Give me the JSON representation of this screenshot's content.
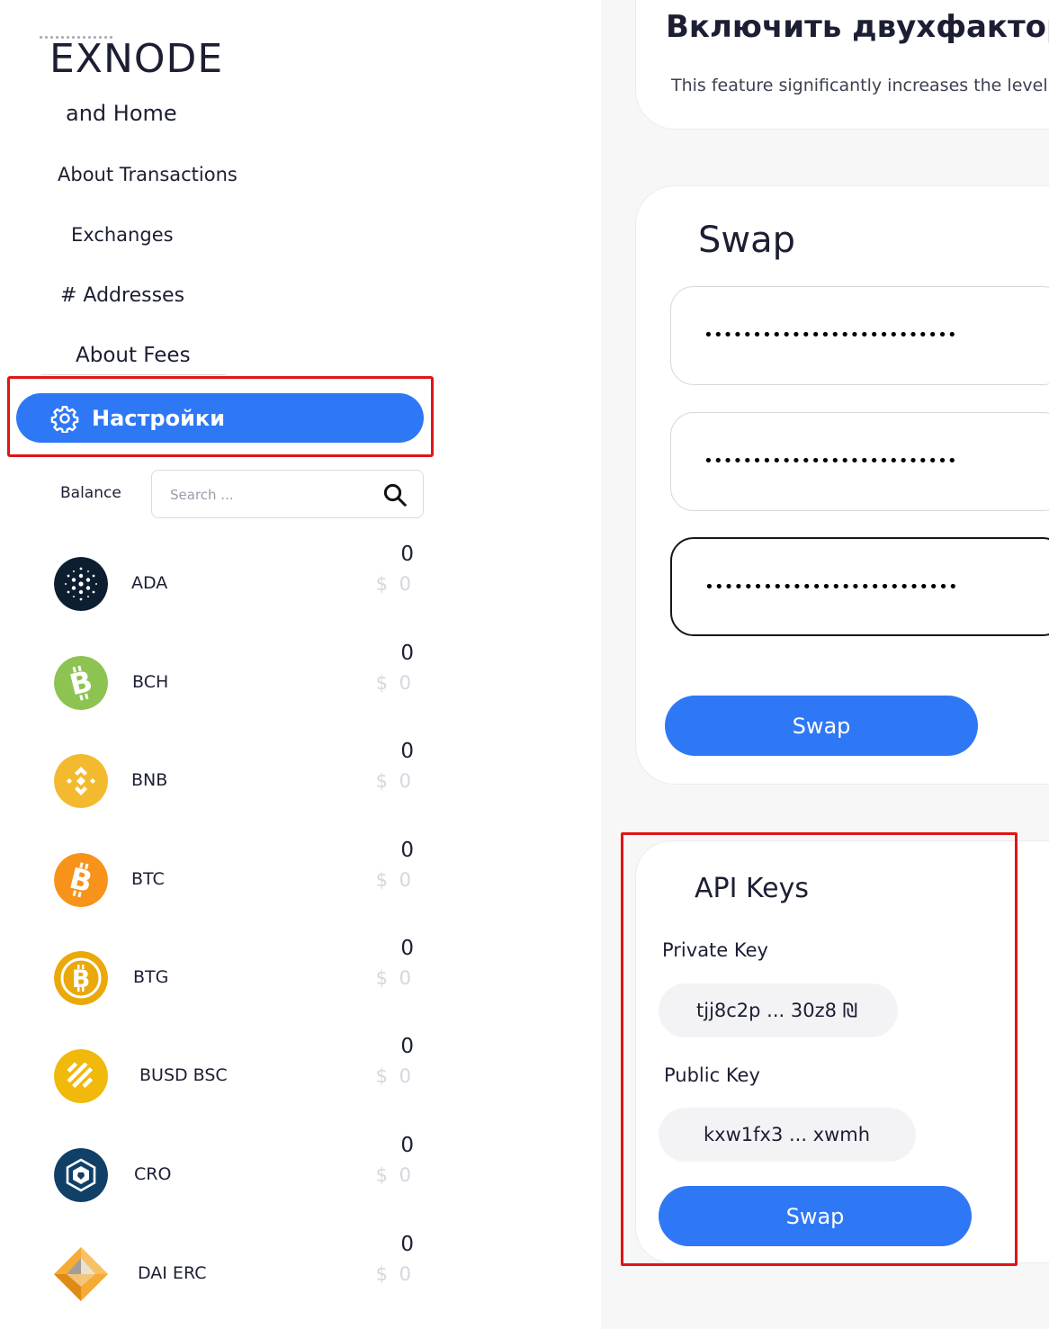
{
  "sidebar": {
    "logo": "EXNODE",
    "nav": {
      "home": "and Home",
      "transactions": "About Transactions",
      "exchanges": "Exchanges",
      "addresses": "# Addresses",
      "fees": "About Fees",
      "settings": "Настройки"
    },
    "balance_label": "Balance",
    "search_placeholder": "Search ...",
    "coins": [
      {
        "name": "ADA",
        "amount": "0",
        "usd": "$ 0",
        "color": "#0d1e30",
        "icon": "cardano-icon"
      },
      {
        "name": "BCH",
        "amount": "0",
        "usd": "$ 0",
        "color": "#8dc351",
        "icon": "bitcoin-cash-icon"
      },
      {
        "name": "BNB",
        "amount": "0",
        "usd": "$ 0",
        "color": "#f3ba2f",
        "icon": "binance-icon"
      },
      {
        "name": "BTC",
        "amount": "0",
        "usd": "$ 0",
        "color": "#f7931a",
        "icon": "bitcoin-icon"
      },
      {
        "name": "BTG",
        "amount": "0",
        "usd": "$ 0",
        "color": "#eba809",
        "icon": "bitcoin-gold-icon"
      },
      {
        "name": "BUSD BSC",
        "amount": "0",
        "usd": "$ 0",
        "color": "#f0b90b",
        "icon": "busd-icon"
      },
      {
        "name": "CRO",
        "amount": "0",
        "usd": "$ 0",
        "color": "#103f68",
        "icon": "cronos-icon"
      },
      {
        "name": "DAI ERC",
        "amount": "0",
        "usd": "$ 0",
        "color": "#f5ac37",
        "icon": "dai-icon"
      }
    ]
  },
  "twofa": {
    "title": "Включить двухфакторну",
    "description": "This feature significantly increases the level"
  },
  "swap_card": {
    "title": "Swap",
    "fields": [
      {
        "value": "••••••••••••••••••••••••••"
      },
      {
        "value": "••••••••••••••••••••••••••"
      },
      {
        "value": "••••••••••••••••••••••••••"
      }
    ],
    "button": "Swap"
  },
  "api_keys": {
    "title": "API Keys",
    "private_label": "Private Key",
    "private_value": "tjj8c2p ... 30z8 ₪",
    "public_label": "Public Key",
    "public_value": "kxw1fx3 ... xwmh",
    "button": "Swap"
  },
  "colors": {
    "accent": "#2f78f5",
    "highlight": "#e01515"
  }
}
